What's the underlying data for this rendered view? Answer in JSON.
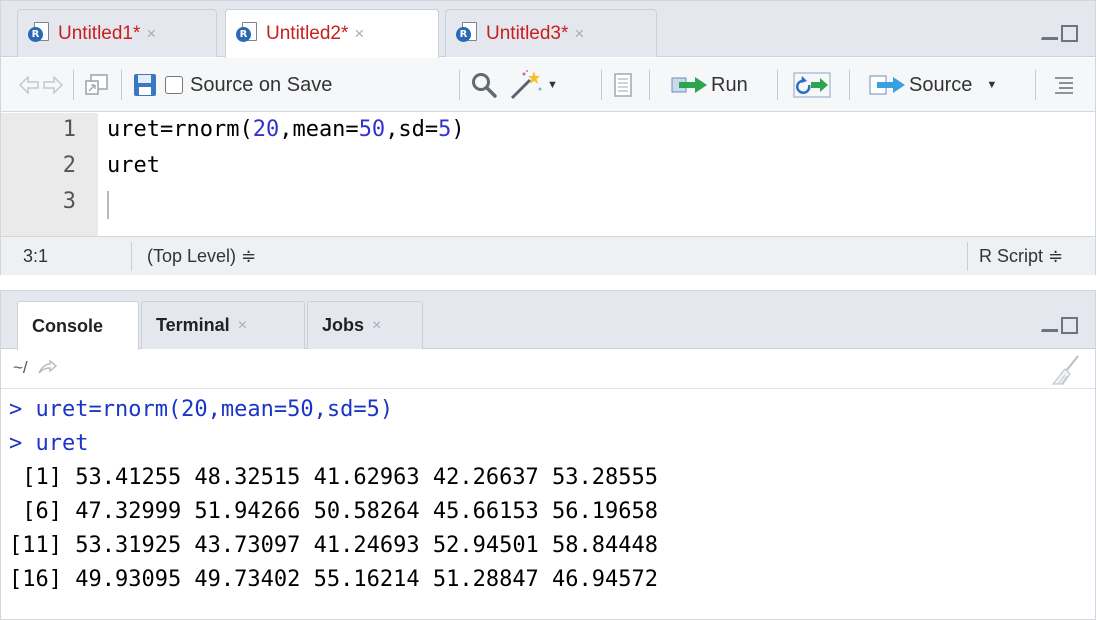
{
  "editor": {
    "tabs": [
      {
        "label": "Untitled1*",
        "close": "×",
        "active": false
      },
      {
        "label": "Untitled2*",
        "close": "×",
        "active": true
      },
      {
        "label": "Untitled3*",
        "close": "×",
        "active": false
      }
    ],
    "toolbar": {
      "source_on_save_label": "Source on Save",
      "source_on_save_checked": false,
      "run_label": "Run",
      "source_label": "Source"
    },
    "code": {
      "line_numbers": [
        "1",
        "2",
        "3"
      ],
      "line1": {
        "prefix": "uret=rnorm(",
        "n": "20",
        "mid1": ",mean=",
        "mean": "50",
        "mid2": ",sd=",
        "sd": "5",
        "suffix": ")"
      },
      "line2": "uret",
      "line3": ""
    },
    "status": {
      "position": "3:1",
      "scope": "(Top Level) ≑",
      "file_type": "R Script ≑"
    }
  },
  "console": {
    "tabs": [
      {
        "label": "Console",
        "close": "",
        "active": true
      },
      {
        "label": "Terminal",
        "close": "×",
        "active": false
      },
      {
        "label": "Jobs",
        "close": "×",
        "active": false
      }
    ],
    "working_dir": "~/",
    "lines": [
      {
        "kind": "in",
        "text": "> uret=rnorm(20,mean=50,sd=5)"
      },
      {
        "kind": "in",
        "text": "> uret"
      },
      {
        "kind": "out",
        "text": " [1] 53.41255 48.32515 41.62963 42.26637 53.28555"
      },
      {
        "kind": "out",
        "text": " [6] 47.32999 51.94266 50.58264 45.66153 56.19658"
      },
      {
        "kind": "out",
        "text": "[11] 53.31925 43.73097 41.24693 52.94501 58.84448"
      },
      {
        "kind": "out",
        "text": "[16] 49.93095 49.73402 55.16214 51.28847 46.94572"
      }
    ]
  },
  "colors": {
    "tab_label": "#c81e1e",
    "console_input": "#1b35c6",
    "code_number": "#3333cc"
  },
  "icons": [
    "r-document-icon",
    "back-arrow-icon",
    "forward-arrow-icon",
    "show-in-window-icon",
    "save-icon",
    "search-icon",
    "magic-wand-icon",
    "compile-report-icon",
    "run-arrow-icon",
    "rerun-icon",
    "source-arrow-icon",
    "outline-icon",
    "minimize-icon",
    "maximize-icon",
    "broom-icon",
    "folder-arrow-icon"
  ]
}
